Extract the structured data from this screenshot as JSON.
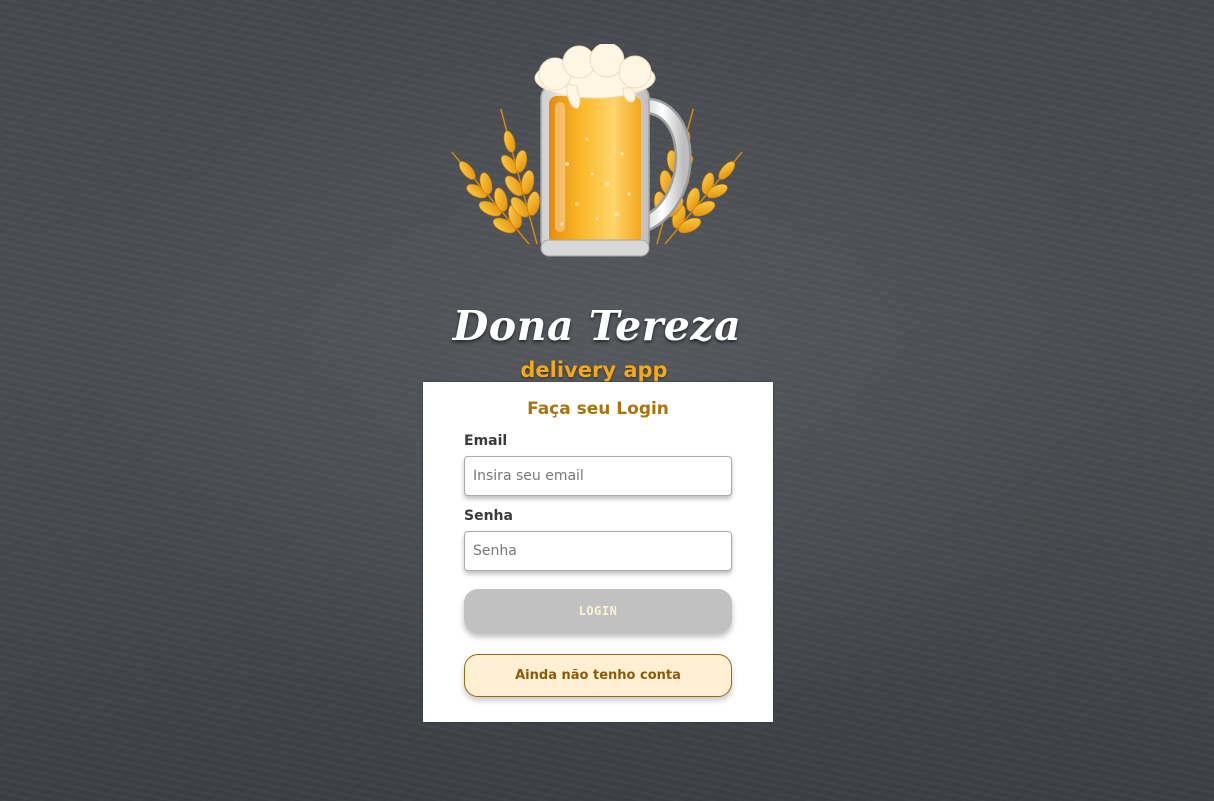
{
  "brand": {
    "name": "Dona Tereza",
    "tagline": "delivery app",
    "logo_icon": "beer-mug-with-wheat-icon"
  },
  "login": {
    "title": "Faça seu Login",
    "email": {
      "label": "Email",
      "placeholder": "Insira seu email",
      "value": ""
    },
    "password": {
      "label": "Senha",
      "placeholder": "Senha",
      "value": ""
    },
    "login_button": "LOGIN",
    "register_button": "Ainda não tenho conta"
  },
  "colors": {
    "accent": "#a8740e",
    "tagline": "#f4a81a",
    "login_disabled_bg": "#c1c1c1",
    "register_bg": "#fff0d4",
    "background": "#474a4f"
  }
}
